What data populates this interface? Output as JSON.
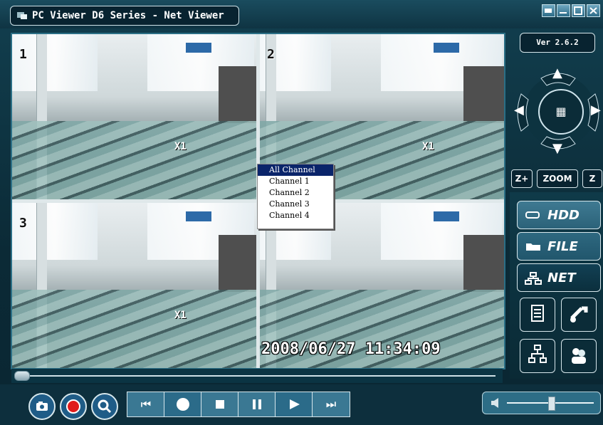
{
  "window": {
    "title": "PC Viewer D6 Series - Net Viewer",
    "controls": [
      "minimize-to-tray",
      "minimize",
      "maximize",
      "close"
    ]
  },
  "version": "Ver 2.6.2",
  "video": {
    "tiles": [
      {
        "label": "1",
        "speed": "X1"
      },
      {
        "label": "2",
        "speed": "X1"
      },
      {
        "label": "3",
        "speed": "X1"
      },
      {
        "label": "",
        "speed": ""
      }
    ],
    "timestamp": "2008/06/27 11:34:09"
  },
  "context_menu": {
    "items": [
      "All Channel",
      "Channel  1",
      "Channel  2",
      "Channel  3",
      "Channel  4"
    ],
    "selected": 0
  },
  "ptz": {
    "zoom_label": "ZOOM",
    "zoom_in": "Z+",
    "zoom_out": "Z"
  },
  "side_buttons": {
    "hdd": "HDD",
    "file": "FILE",
    "net": "NET"
  },
  "colors": {
    "accent": "#2c6d8a",
    "menu_selected": "#0a246a",
    "background": "#0d2f3d"
  }
}
